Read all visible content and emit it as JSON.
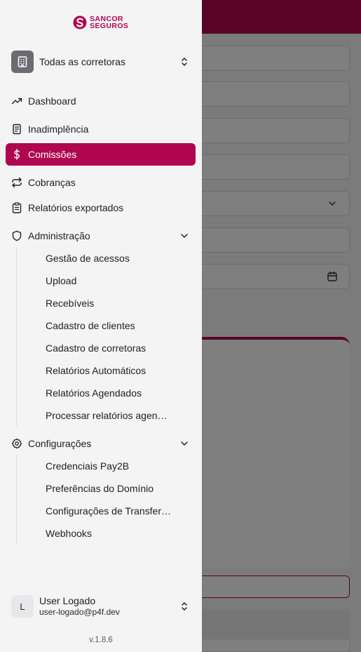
{
  "brand": {
    "logo_text_line1": "SANCOR",
    "logo_text_line2": "SEGUROS",
    "color": "#b0064f"
  },
  "org_switcher": {
    "label": "Todas as corretoras",
    "icon": "building-icon"
  },
  "nav": {
    "dashboard": "Dashboard",
    "inadimplencia": "Inadimplência",
    "comissoes": "Comissões",
    "cobrancas": "Cobranças",
    "relatorios_exportados": "Relatórios exportados",
    "administracao": "Administração",
    "configuracoes": "Configurações"
  },
  "administracao_items": [
    "Gestão de acessos",
    "Upload",
    "Recebíveis",
    "Cadastro de clientes",
    "Cadastro de corretoras",
    "Relatórios Automáticos",
    "Relatórios Agendados",
    "Processar relatórios agendados"
  ],
  "configuracoes_items": [
    "Credenciais Pay2B",
    "Preferências do Domínio",
    "Configurações de Transferência",
    "Webhooks"
  ],
  "active_item": "Comissões",
  "user": {
    "initial": "L",
    "name": "User Logado",
    "email": "user-logado@p4f.dev"
  },
  "version": "v.1.8.6",
  "colors": {
    "accent": "#b0064f",
    "sidebar_bg": "#f4f4f5",
    "overlay": "rgba(0,0,0,0.5)"
  }
}
